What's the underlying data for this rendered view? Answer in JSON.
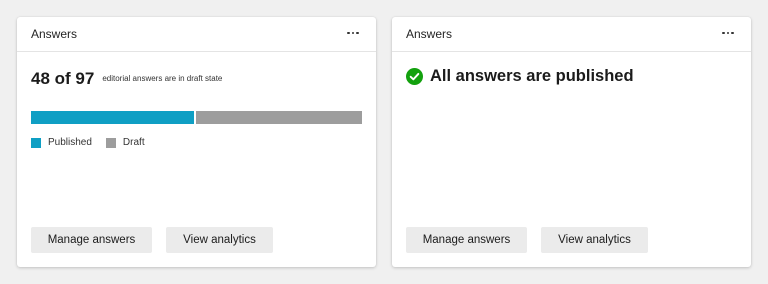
{
  "cards": [
    {
      "title": "Answers",
      "summary": {
        "count": "48 of 97",
        "description": "editorial answers are in draft state"
      },
      "progress": {
        "published": 48,
        "draft": 49,
        "total": 97,
        "published_color": "#0f9fc4",
        "draft_color": "#9d9d9d"
      },
      "legend": {
        "published_label": "Published",
        "draft_label": "Draft"
      },
      "buttons": {
        "manage": "Manage answers",
        "analytics": "View analytics"
      }
    },
    {
      "title": "Answers",
      "status": {
        "text": "All answers are published",
        "icon": "check-circle-icon",
        "color": "#13a10e"
      },
      "buttons": {
        "manage": "Manage answers",
        "analytics": "View analytics"
      }
    }
  ]
}
